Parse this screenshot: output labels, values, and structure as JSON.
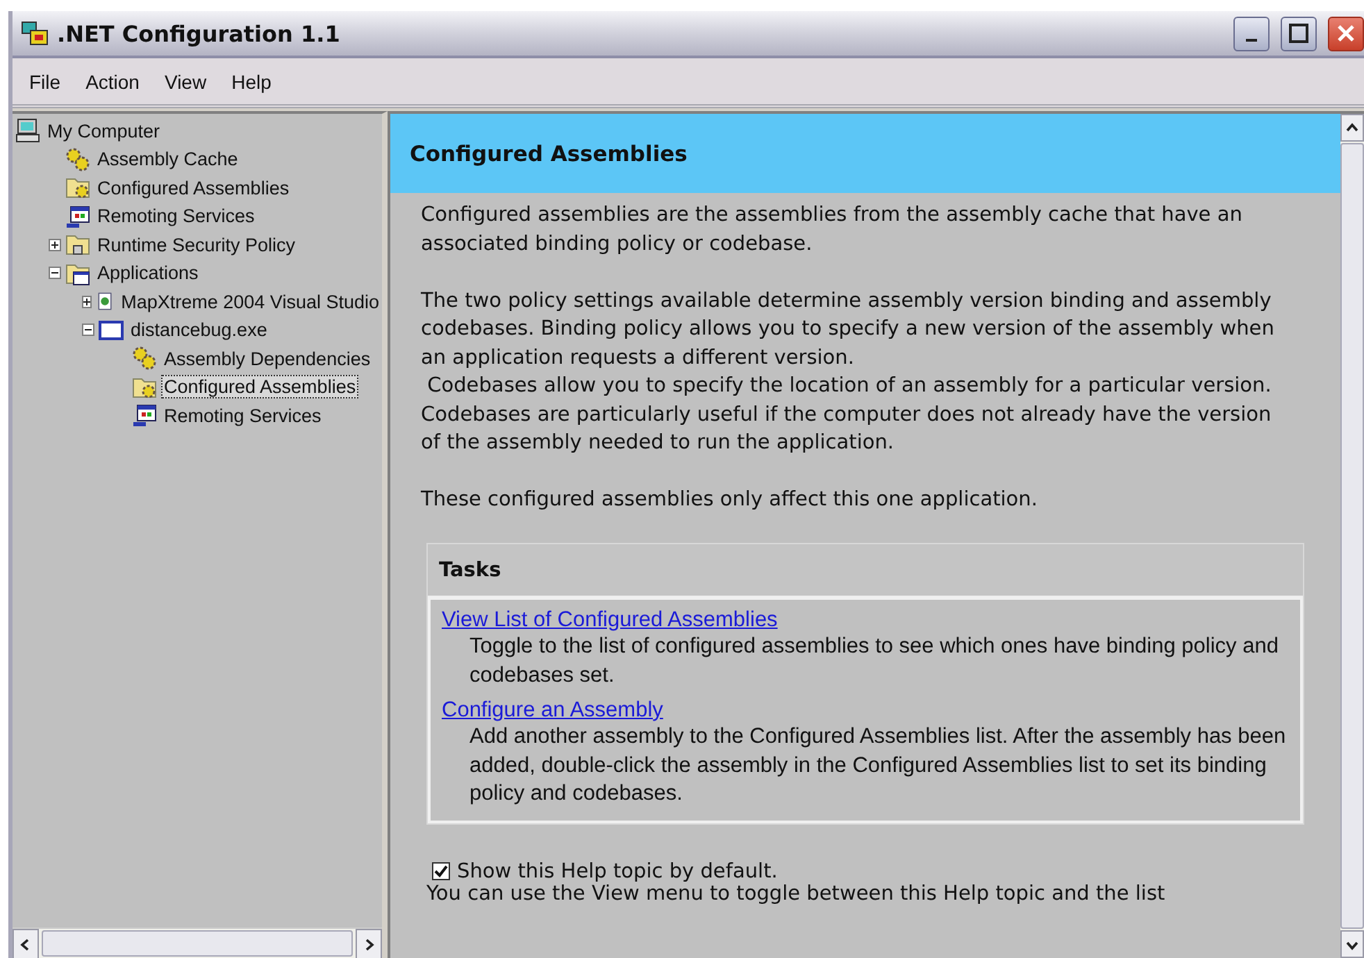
{
  "window": {
    "title": ".NET Configuration 1.1"
  },
  "menu": [
    "File",
    "Action",
    "View",
    "Help"
  ],
  "tree": [
    {
      "label": "My Computer",
      "kind": "computer",
      "selected": false,
      "children": [
        {
          "label": "Assembly Cache",
          "kind": "gears",
          "selected": false
        },
        {
          "label": "Configured Assemblies",
          "kind": "folder",
          "selected": false
        },
        {
          "label": "Remoting Services",
          "kind": "remoting",
          "selected": false
        },
        {
          "label": "Runtime Security Policy",
          "kind": "security",
          "selected": false,
          "expanded": false
        },
        {
          "label": "Applications",
          "kind": "apps",
          "selected": false,
          "expanded": true,
          "children": [
            {
              "label": "MapXtreme 2004 Visual Studio",
              "kind": "app",
              "selected": false,
              "expanded": false
            },
            {
              "label": "distancebug.exe",
              "kind": "window",
              "selected": false,
              "expanded": true,
              "children": [
                {
                  "label": "Assembly Dependencies",
                  "kind": "gears",
                  "selected": false
                },
                {
                  "label": "Configured Assemblies",
                  "kind": "folder",
                  "selected": true
                },
                {
                  "label": "Remoting Services",
                  "kind": "remoting",
                  "selected": false
                }
              ]
            }
          ]
        }
      ]
    }
  ],
  "content": {
    "heading": "Configured Assemblies",
    "paragraphs": [
      "Configured assemblies are the assemblies from the assembly cache that have an associated binding policy or codebase.",
      "The two policy settings available determine assembly version binding and assembly codebases. Binding policy allows you to specify a new version of the assembly when an application requests a different version.\n Codebases allow you to specify the location of an assembly for a particular version. Codebases are particularly useful if the computer does not already have the version of the assembly needed to run the application.",
      "These configured assemblies only affect this one application."
    ],
    "tasks": {
      "title": "Tasks",
      "items": [
        {
          "link": "View List of Configured Assemblies",
          "description": "Toggle to the list of configured assemblies to see which ones have binding policy and codebases set."
        },
        {
          "link": "Configure an Assembly",
          "description": "Add another assembly to the Configured Assemblies list. After the assembly has been added, double-click the assembly in the Configured Assemblies list to set its binding policy and codebases."
        }
      ]
    },
    "show_help": {
      "label": "Show this Help topic by default.",
      "checked": true
    },
    "footer": "You can use the View menu to toggle between this Help topic and the list"
  }
}
